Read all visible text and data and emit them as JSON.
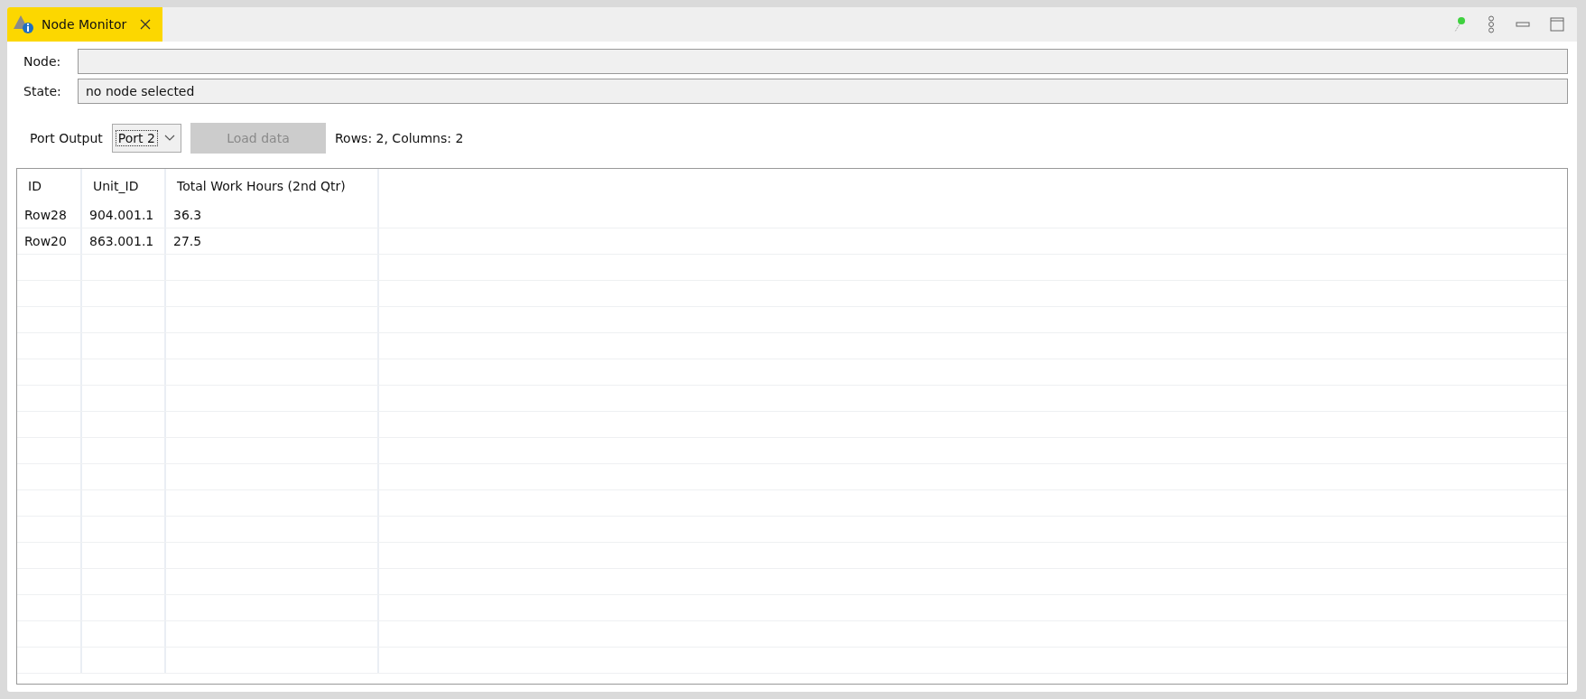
{
  "tab": {
    "title": "Node Monitor",
    "selected": true
  },
  "node": {
    "label": "Node:"
  },
  "state": {
    "label": "State:",
    "value": "no node selected"
  },
  "toolbar": {
    "port_label": "Port Output",
    "port_value": "Port 2",
    "load_button": {
      "label": "Load data",
      "disabled": true
    },
    "summary": "Rows: 2, Columns: 2"
  },
  "table": {
    "columns": [
      "ID",
      "Unit_ID",
      "Total Work Hours (2nd Qtr)"
    ],
    "rows": [
      [
        "Row28",
        "904.001.1",
        "36.3"
      ],
      [
        "Row20",
        "863.001.1",
        "27.5"
      ]
    ]
  }
}
